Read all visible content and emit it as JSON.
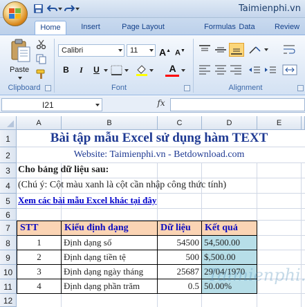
{
  "quick_access": {
    "save_icon": "save-icon",
    "undo_icon": "undo-icon",
    "redo_icon": "redo-icon"
  },
  "brand": "Taimienphi.vn",
  "tabs": [
    "Home",
    "Insert",
    "Page Layout",
    "Formulas",
    "Data",
    "Review"
  ],
  "ribbon": {
    "clipboard": {
      "paste_label": "Paste",
      "group_label": "Clipboard"
    },
    "font": {
      "font_name": "Calibri",
      "font_size": "11",
      "group_label": "Font",
      "bold": "B",
      "italic": "I",
      "underline": "U",
      "grow": "A",
      "shrink": "A",
      "color_a": "A"
    },
    "alignment": {
      "group_label": "Alignment"
    }
  },
  "formula_bar": {
    "name_box": "I21",
    "fx": "fx",
    "formula": ""
  },
  "columns": [
    "A",
    "B",
    "C",
    "D",
    "E"
  ],
  "rows": [
    "1",
    "2",
    "3",
    "4",
    "5",
    "6",
    "7",
    "8",
    "9",
    "10",
    "11",
    "12"
  ],
  "sheet": {
    "title": "Bài tập mẫu Excel sử dụng hàm TEXT",
    "website": "Website: Taimienphi.vn - Betdownload.com",
    "r3": "Cho bảng dữ liệu sau:",
    "r4": "(Chú ý: Cột màu xanh là cột cần nhập công thức tính)",
    "link": "Xem các bài mẫu Excel khác tại đây",
    "table_header": {
      "stt": "STT",
      "kieu": "Kiểu định dạng",
      "dulieu": "Dữ liệu",
      "ketqua": "Kết quả"
    },
    "table_rows": [
      {
        "stt": "1",
        "kieu": "Định dạng số",
        "dulieu": "54500",
        "ketqua": "54,500.00"
      },
      {
        "stt": "2",
        "kieu": "Định dạng tiền tệ",
        "dulieu": "500",
        "ketqua": "$,500.00"
      },
      {
        "stt": "3",
        "kieu": "Định dạng ngày tháng",
        "dulieu": "25687",
        "ketqua": "29/04/1970"
      },
      {
        "stt": "4",
        "kieu": "Định dạng phần trăm",
        "dulieu": "0.5",
        "ketqua": "50.00%"
      }
    ]
  },
  "watermark": "Taimienphi.vn",
  "colors": {
    "ribbon_blue": "#dde8f6",
    "header_fill": "#fbd4b4",
    "result_fill": "#b7dee8",
    "header_text": "#0d0dbf",
    "title_text": "#1f3a93"
  }
}
